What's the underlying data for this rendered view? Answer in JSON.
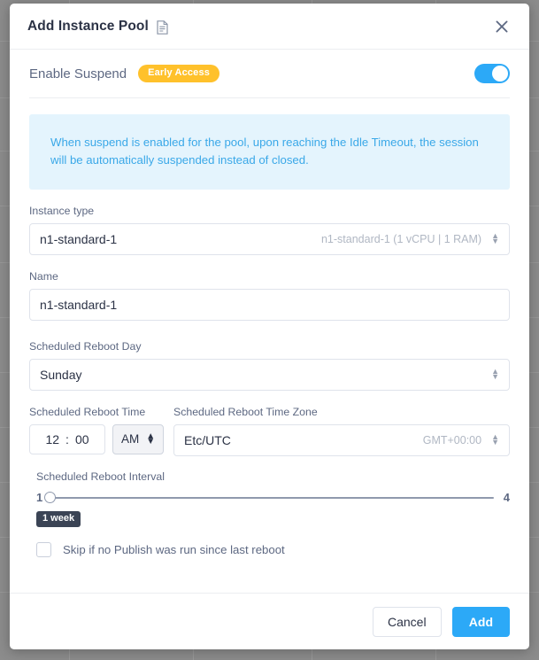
{
  "dialog": {
    "title": "Add Instance Pool",
    "title_icon": "document-icon",
    "close_icon": "close-icon"
  },
  "suspend": {
    "label": "Enable Suspend",
    "badge": "Early Access",
    "toggle_on": true,
    "toggle_color": "#2ca9f7",
    "badge_color": "#ffc12b"
  },
  "info_banner": {
    "text": "When suspend is enabled for the pool, upon reaching the Idle Timeout, the session will be automatically suspended instead of closed.",
    "background": "#e4f4fd",
    "text_color": "#3aa8e8"
  },
  "fields": {
    "instance_type": {
      "label": "Instance type",
      "value": "n1-standard-1",
      "hint": "n1-standard-1 (1 vCPU | 1 RAM)"
    },
    "name": {
      "label": "Name",
      "value": "n1-standard-1"
    },
    "reboot_day": {
      "label": "Scheduled Reboot Day",
      "value": "Sunday"
    },
    "reboot_time": {
      "label": "Scheduled Reboot Time",
      "hours": "12",
      "separator": ":",
      "minutes": "00",
      "meridiem": "AM"
    },
    "reboot_timezone": {
      "label": "Scheduled Reboot Time Zone",
      "value": "Etc/UTC",
      "hint": "GMT+00:00"
    },
    "reboot_interval": {
      "label": "Scheduled Reboot Interval",
      "min": "1",
      "max": "4",
      "value": "1",
      "tooltip": "1 week"
    },
    "skip_publish": {
      "label": "Skip if no Publish was run since last reboot",
      "checked": false
    }
  },
  "footer": {
    "cancel_label": "Cancel",
    "add_label": "Add"
  }
}
